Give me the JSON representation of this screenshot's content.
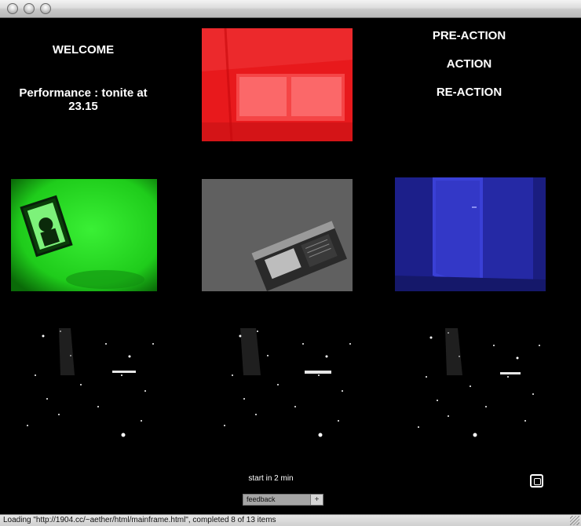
{
  "window": {
    "title": ""
  },
  "left_text": {
    "welcome": "WELCOME",
    "performance": "Performance : tonite at 23.15"
  },
  "right_text": {
    "pre_action": "PRE-ACTION",
    "action": "ACTION",
    "re_action": "RE-ACTION"
  },
  "bottom": {
    "start_text": "start in 2 min",
    "feedback_label": "feedback",
    "feedback_button": "+"
  },
  "status": {
    "text": "Loading \"http://1904.cc/~aether/html/mainframe.html\", completed 8 of 13 items"
  },
  "colors": {
    "red_tile": "#e8191c",
    "green_tile": "#20d51c",
    "gray_tile": "#6a6a6a",
    "blue_tile": "#2a2fb8"
  },
  "icons": [
    "window-close-icon",
    "window-minimize-icon",
    "window-zoom-icon",
    "fullscreen-icon",
    "resize-grip-icon"
  ]
}
